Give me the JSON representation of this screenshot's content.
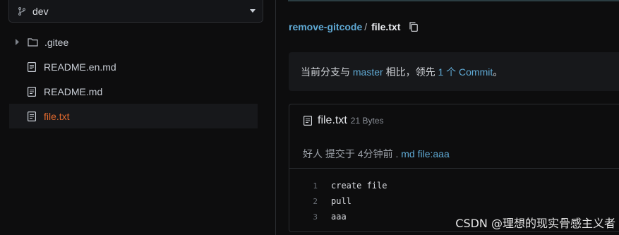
{
  "sidebar": {
    "branch": "dev",
    "items": [
      {
        "label": ".gitee",
        "type": "folder"
      },
      {
        "label": "README.en.md",
        "type": "file"
      },
      {
        "label": "README.md",
        "type": "file"
      },
      {
        "label": "file.txt",
        "type": "file",
        "active": true
      }
    ]
  },
  "breadcrumb": {
    "repo": "remove-gitcode",
    "separator": "/",
    "file": "file.txt"
  },
  "compare": {
    "prefix": "当前分支与",
    "branch": "master",
    "middle": "相比，领先",
    "ahead": "1 个 Commit",
    "suffix": "。"
  },
  "file": {
    "name": "file.txt",
    "size": "21 Bytes",
    "commit": {
      "author": "好人",
      "action": "提交于",
      "time": "4分钟前",
      "dot": ".",
      "message": "md file:aaa"
    },
    "lines": [
      {
        "no": "1",
        "text": "create file"
      },
      {
        "no": "2",
        "text": "pull"
      },
      {
        "no": "3",
        "text": "aaa"
      }
    ]
  },
  "watermark": "CSDN @理想的现实骨感主义者",
  "colors": {
    "accent_orange": "#e0692e",
    "link_blue": "#5fa9d4",
    "background": "#0d0d0e"
  },
  "icons": [
    "branch-icon",
    "chevron-down-icon",
    "chevron-right-icon",
    "folder-icon",
    "file-icon",
    "copy-icon"
  ]
}
